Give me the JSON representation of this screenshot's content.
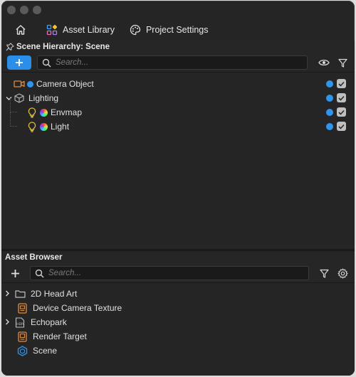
{
  "nav": {
    "home_icon": "home-icon",
    "asset_library": "Asset Library",
    "project_settings": "Project Settings"
  },
  "scene": {
    "header": "Scene Hierarchy: Scene",
    "search_placeholder": "Search...",
    "items": [
      {
        "label": "Camera Object",
        "icon": "camera-icon",
        "dot": "#2f95ee"
      },
      {
        "label": "Lighting",
        "icon": "cube-icon"
      },
      {
        "label": "Envmap",
        "icon": "lightbulb-icon"
      },
      {
        "label": "Light",
        "icon": "lightbulb-icon"
      }
    ]
  },
  "assets": {
    "header": "Asset Browser",
    "search_placeholder": "Search...",
    "items": [
      {
        "label": "2D Head Art",
        "icon": "folder-icon"
      },
      {
        "label": "Device Camera Texture",
        "icon": "texture-icon"
      },
      {
        "label": "Echopark",
        "icon": "hdr-icon"
      },
      {
        "label": "Render Target",
        "icon": "render-target-icon"
      },
      {
        "label": "Scene",
        "icon": "scene-icon"
      }
    ]
  },
  "colors": {
    "accent": "#2b8ee8",
    "orange_icon": "#e08a3c",
    "yellow_icon": "#e8c23a",
    "blue_icon": "#2f95ee"
  }
}
